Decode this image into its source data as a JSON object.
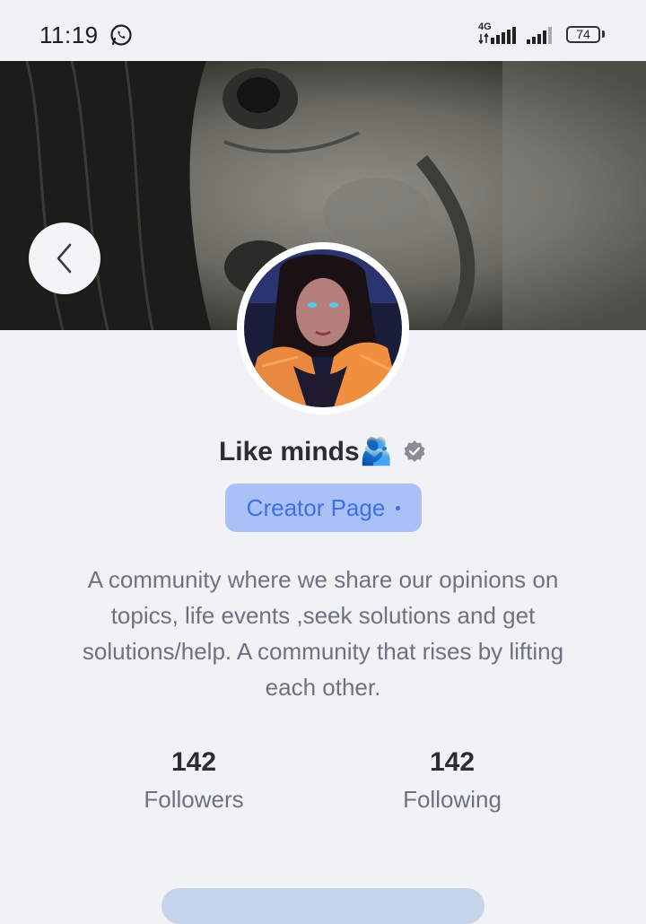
{
  "status_bar": {
    "time": "11:19",
    "network": "4G",
    "battery": "74"
  },
  "profile": {
    "name": "Like minds",
    "name_emoji": "🫂",
    "verified_icon": "check-badge-icon",
    "badge_label": "Creator Page",
    "bio": "A community where we share our opinions on topics, life events ,seek solutions and get solutions/help. A community that rises by lifting each other.",
    "followers_count": "142",
    "followers_label": "Followers",
    "following_count": "142",
    "following_label": "Following"
  },
  "colors": {
    "accent": "#3d70e6",
    "badge_bg": "#a9c1f6",
    "text_primary": "#2a2d36",
    "text_secondary": "#6d7280",
    "background": "#f1f2f6"
  }
}
